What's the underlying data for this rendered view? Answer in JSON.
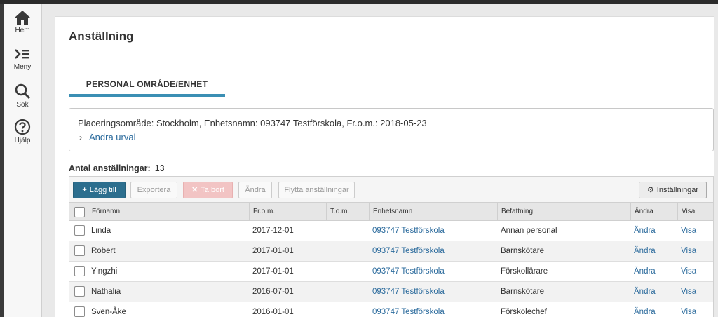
{
  "nav": {
    "items": [
      {
        "label": "Hem",
        "icon": "home-icon"
      },
      {
        "label": "Meny",
        "icon": "menu-icon"
      },
      {
        "label": "Sök",
        "icon": "search-icon"
      },
      {
        "label": "Hjälp",
        "icon": "help-icon"
      }
    ]
  },
  "page": {
    "title": "Anställning",
    "tab": "PERSONAL OMRÅDE/ENHET"
  },
  "filter": {
    "summary": "Placeringsområde: Stockholm, Enhetsnamn: 093747 Testförskola, Fr.o.m.: 2018-05-23",
    "change_label": "Ändra urval"
  },
  "count": {
    "label": "Antal anställningar:",
    "value": "13"
  },
  "toolbar": {
    "add": "Lägg till",
    "export": "Exportera",
    "delete": "Ta bort",
    "edit": "Ändra",
    "move": "Flytta anställningar",
    "settings": "Inställningar"
  },
  "table": {
    "headers": {
      "firstname": "Förnamn",
      "from": "Fr.o.m.",
      "to": "T.o.m.",
      "unit": "Enhetsnamn",
      "position": "Befattning",
      "edit": "Ändra",
      "view": "Visa"
    },
    "rows": [
      {
        "firstname": "Linda",
        "from": "2017-12-01",
        "to": "",
        "unit": "093747 Testförskola",
        "position": "Annan personal",
        "edit": "Ändra",
        "view": "Visa"
      },
      {
        "firstname": "Robert",
        "from": "2017-01-01",
        "to": "",
        "unit": "093747 Testförskola",
        "position": "Barnskötare",
        "edit": "Ändra",
        "view": "Visa"
      },
      {
        "firstname": "Yingzhi",
        "from": "2017-01-01",
        "to": "",
        "unit": "093747 Testförskola",
        "position": "Förskollärare",
        "edit": "Ändra",
        "view": "Visa"
      },
      {
        "firstname": "Nathalia",
        "from": "2016-07-01",
        "to": "",
        "unit": "093747 Testförskola",
        "position": "Barnskötare",
        "edit": "Ändra",
        "view": "Visa"
      },
      {
        "firstname": "Sven-Åke",
        "from": "2016-01-01",
        "to": "",
        "unit": "093747 Testförskola",
        "position": "Förskolechef",
        "edit": "Ändra",
        "view": "Visa"
      }
    ]
  },
  "colors": {
    "accent": "#3b8fb4",
    "primary_button": "#2c6e8e",
    "link": "#2a6a9c",
    "danger_disabled": "#f2c4c4"
  }
}
